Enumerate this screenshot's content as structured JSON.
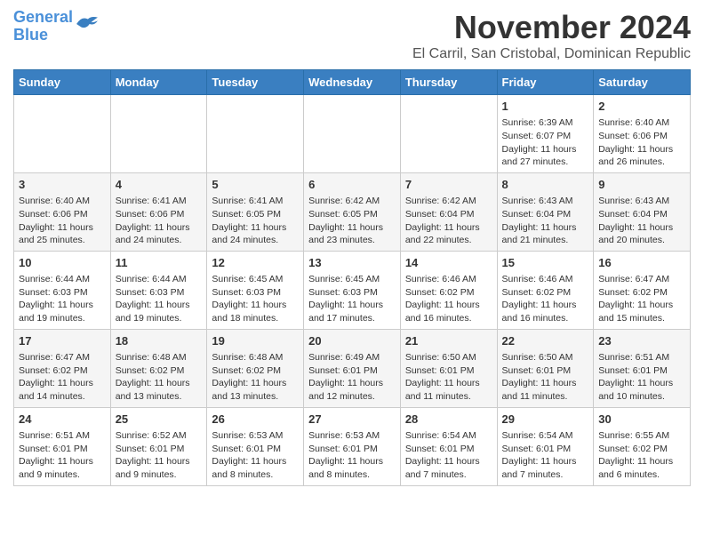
{
  "header": {
    "logo_line1": "General",
    "logo_line2": "Blue",
    "month": "November 2024",
    "location": "El Carril, San Cristobal, Dominican Republic"
  },
  "weekdays": [
    "Sunday",
    "Monday",
    "Tuesday",
    "Wednesday",
    "Thursday",
    "Friday",
    "Saturday"
  ],
  "weeks": [
    [
      {
        "day": "",
        "info": ""
      },
      {
        "day": "",
        "info": ""
      },
      {
        "day": "",
        "info": ""
      },
      {
        "day": "",
        "info": ""
      },
      {
        "day": "",
        "info": ""
      },
      {
        "day": "1",
        "info": "Sunrise: 6:39 AM\nSunset: 6:07 PM\nDaylight: 11 hours and 27 minutes."
      },
      {
        "day": "2",
        "info": "Sunrise: 6:40 AM\nSunset: 6:06 PM\nDaylight: 11 hours and 26 minutes."
      }
    ],
    [
      {
        "day": "3",
        "info": "Sunrise: 6:40 AM\nSunset: 6:06 PM\nDaylight: 11 hours and 25 minutes."
      },
      {
        "day": "4",
        "info": "Sunrise: 6:41 AM\nSunset: 6:06 PM\nDaylight: 11 hours and 24 minutes."
      },
      {
        "day": "5",
        "info": "Sunrise: 6:41 AM\nSunset: 6:05 PM\nDaylight: 11 hours and 24 minutes."
      },
      {
        "day": "6",
        "info": "Sunrise: 6:42 AM\nSunset: 6:05 PM\nDaylight: 11 hours and 23 minutes."
      },
      {
        "day": "7",
        "info": "Sunrise: 6:42 AM\nSunset: 6:04 PM\nDaylight: 11 hours and 22 minutes."
      },
      {
        "day": "8",
        "info": "Sunrise: 6:43 AM\nSunset: 6:04 PM\nDaylight: 11 hours and 21 minutes."
      },
      {
        "day": "9",
        "info": "Sunrise: 6:43 AM\nSunset: 6:04 PM\nDaylight: 11 hours and 20 minutes."
      }
    ],
    [
      {
        "day": "10",
        "info": "Sunrise: 6:44 AM\nSunset: 6:03 PM\nDaylight: 11 hours and 19 minutes."
      },
      {
        "day": "11",
        "info": "Sunrise: 6:44 AM\nSunset: 6:03 PM\nDaylight: 11 hours and 19 minutes."
      },
      {
        "day": "12",
        "info": "Sunrise: 6:45 AM\nSunset: 6:03 PM\nDaylight: 11 hours and 18 minutes."
      },
      {
        "day": "13",
        "info": "Sunrise: 6:45 AM\nSunset: 6:03 PM\nDaylight: 11 hours and 17 minutes."
      },
      {
        "day": "14",
        "info": "Sunrise: 6:46 AM\nSunset: 6:02 PM\nDaylight: 11 hours and 16 minutes."
      },
      {
        "day": "15",
        "info": "Sunrise: 6:46 AM\nSunset: 6:02 PM\nDaylight: 11 hours and 16 minutes."
      },
      {
        "day": "16",
        "info": "Sunrise: 6:47 AM\nSunset: 6:02 PM\nDaylight: 11 hours and 15 minutes."
      }
    ],
    [
      {
        "day": "17",
        "info": "Sunrise: 6:47 AM\nSunset: 6:02 PM\nDaylight: 11 hours and 14 minutes."
      },
      {
        "day": "18",
        "info": "Sunrise: 6:48 AM\nSunset: 6:02 PM\nDaylight: 11 hours and 13 minutes."
      },
      {
        "day": "19",
        "info": "Sunrise: 6:48 AM\nSunset: 6:02 PM\nDaylight: 11 hours and 13 minutes."
      },
      {
        "day": "20",
        "info": "Sunrise: 6:49 AM\nSunset: 6:01 PM\nDaylight: 11 hours and 12 minutes."
      },
      {
        "day": "21",
        "info": "Sunrise: 6:50 AM\nSunset: 6:01 PM\nDaylight: 11 hours and 11 minutes."
      },
      {
        "day": "22",
        "info": "Sunrise: 6:50 AM\nSunset: 6:01 PM\nDaylight: 11 hours and 11 minutes."
      },
      {
        "day": "23",
        "info": "Sunrise: 6:51 AM\nSunset: 6:01 PM\nDaylight: 11 hours and 10 minutes."
      }
    ],
    [
      {
        "day": "24",
        "info": "Sunrise: 6:51 AM\nSunset: 6:01 PM\nDaylight: 11 hours and 9 minutes."
      },
      {
        "day": "25",
        "info": "Sunrise: 6:52 AM\nSunset: 6:01 PM\nDaylight: 11 hours and 9 minutes."
      },
      {
        "day": "26",
        "info": "Sunrise: 6:53 AM\nSunset: 6:01 PM\nDaylight: 11 hours and 8 minutes."
      },
      {
        "day": "27",
        "info": "Sunrise: 6:53 AM\nSunset: 6:01 PM\nDaylight: 11 hours and 8 minutes."
      },
      {
        "day": "28",
        "info": "Sunrise: 6:54 AM\nSunset: 6:01 PM\nDaylight: 11 hours and 7 minutes."
      },
      {
        "day": "29",
        "info": "Sunrise: 6:54 AM\nSunset: 6:01 PM\nDaylight: 11 hours and 7 minutes."
      },
      {
        "day": "30",
        "info": "Sunrise: 6:55 AM\nSunset: 6:02 PM\nDaylight: 11 hours and 6 minutes."
      }
    ]
  ]
}
